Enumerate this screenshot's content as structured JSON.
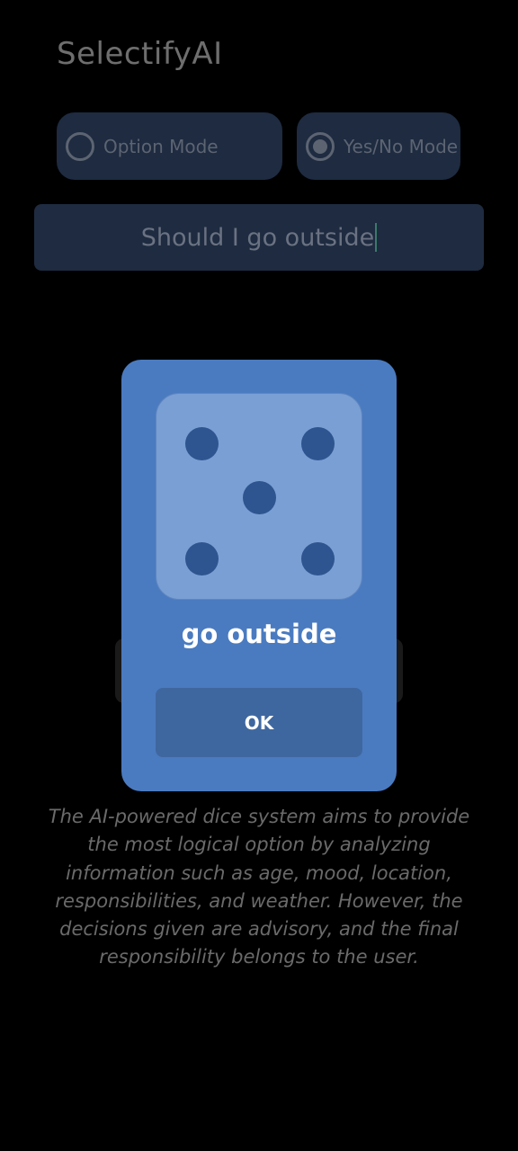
{
  "app": {
    "title": "SelectifyAI"
  },
  "modes": {
    "option": {
      "label": "Option Mode",
      "selected": false
    },
    "yesno": {
      "label": "Yes/No Mode",
      "selected": true
    }
  },
  "question_input": {
    "value": "Should I go outside"
  },
  "dialog": {
    "die_face": 5,
    "result": "go outside",
    "ok_label": "OK"
  },
  "disclaimer": "The AI-powered dice system aims to provide the most logical option by analyzing information such as age, mood, location, responsibilities, and weather. However, the decisions given are advisory, and the final responsibility belongs to the user.",
  "colors": {
    "dialog": "#4a7bc0",
    "die": "#7a9fd4",
    "pip": "#2f5590",
    "ok_button": "#3f679f",
    "field": "#1e2b40"
  }
}
